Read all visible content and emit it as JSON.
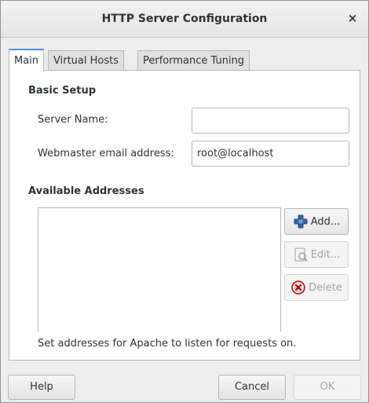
{
  "window": {
    "title": "HTTP Server Configuration",
    "close_glyph": "×"
  },
  "tabs": [
    {
      "label": "Main",
      "active": true
    },
    {
      "label": "Virtual Hosts",
      "active": false
    },
    {
      "label": "Performance Tuning",
      "active": false
    }
  ],
  "basic_setup": {
    "heading": "Basic Setup",
    "server_name_label": "Server Name:",
    "server_name_value": "",
    "webmaster_label": "Webmaster email address:",
    "webmaster_value": "root@localhost"
  },
  "addresses": {
    "heading": "Available Addresses",
    "items": [],
    "add_label": "Add...",
    "edit_label": "Edit...",
    "delete_label": "Delete",
    "hint": "Set addresses for Apache to listen for requests on."
  },
  "footer": {
    "help_label": "Help",
    "cancel_label": "Cancel",
    "ok_label": "OK"
  },
  "icons": {
    "add": "add-icon",
    "edit": "edit-icon",
    "delete": "delete-icon",
    "close": "close-icon"
  },
  "colors": {
    "accent_tab": "#4a90d9",
    "add_icon": "#3465a4",
    "delete_icon": "#cc0000"
  }
}
